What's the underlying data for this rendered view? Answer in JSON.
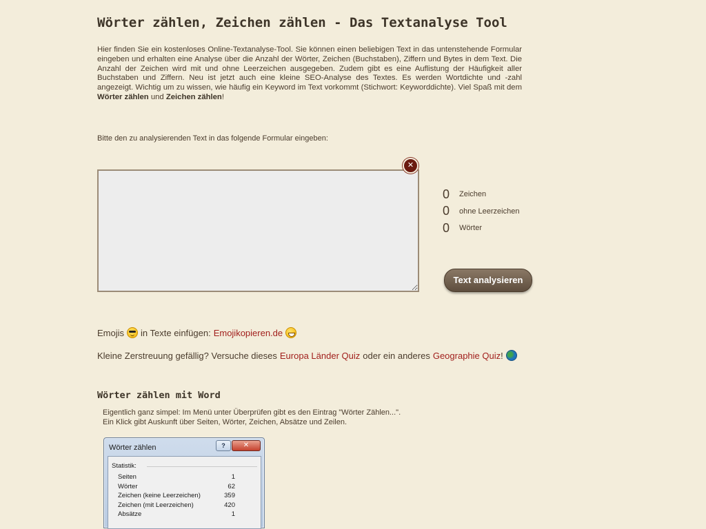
{
  "header": {
    "title": "Wörter zählen, Zeichen zählen - Das Textanalyse Tool"
  },
  "intro": {
    "text_a": "Hier finden Sie ein kostenloses Online-Textanalyse-Tool. Sie können einen beliebigen Text in das untenstehende Formular eingeben und erhalten eine Analyse über die Anzahl der Wörter, Zeichen (Buchstaben), Ziffern und Bytes in dem Text. Die Anzahl der Zeichen wird mit und ohne Leerzeichen ausgegeben. Zudem gibt es eine Auflistung der Häufigkeit aller Buchstaben und Ziffern. Neu ist jetzt auch eine kleine SEO-Analyse des Textes. Es werden Wortdichte und -zahl angezeigt. Wichtig um zu wissen, wie häufig ein Keyword im Text vorkommt (Stichwort: Keyworddichte). Viel Spaß mit dem ",
    "bold_a": "Wörter zählen",
    "text_b": " und ",
    "bold_b": "Zeichen zählen",
    "text_c": "!"
  },
  "form": {
    "prompt": "Bitte den zu analysierenden Text in das folgende Formular eingeben:",
    "textarea_value": "",
    "clear_symbol": "✕",
    "analyze_label": "Text analysieren"
  },
  "counts": [
    {
      "value": "0",
      "label": "Zeichen"
    },
    {
      "value": "0",
      "label": "ohne Leerzeichen"
    },
    {
      "value": "0",
      "label": "Wörter"
    }
  ],
  "emoji_line": {
    "prefix": "Emojis",
    "middle": "in Texte einfügen:",
    "link": "Emojikopieren.de",
    "icons": [
      "smiling-face-with-sunglasses-icon",
      "grinning-sweat-face-icon"
    ]
  },
  "quiz_line": {
    "prefix": "Kleine Zerstreuung gefällig? Versuche dieses",
    "link1": "Europa Länder Quiz",
    "middle": "oder ein anderes",
    "link2": "Geographie Quiz",
    "suffix": "!",
    "icon": "globe-icon"
  },
  "word_section": {
    "heading": "Wörter zählen mit Word",
    "line1": "Eigentlich ganz simpel: Im Menü unter Überprüfen gibt es den Eintrag \"Wörter Zählen...\".",
    "line2": "Ein Klick gibt Auskunft über Seiten, Wörter, Zeichen, Absätze und Zeilen."
  },
  "word_dialog": {
    "title": "Wörter zählen",
    "help_symbol": "?",
    "close_symbol": "✕",
    "stat_heading": "Statistik:",
    "rows": [
      {
        "label": "Seiten",
        "value": "1"
      },
      {
        "label": "Wörter",
        "value": "62"
      },
      {
        "label": "Zeichen (keine Leerzeichen)",
        "value": "359"
      },
      {
        "label": "Zeichen (mit Leerzeichen)",
        "value": "420"
      },
      {
        "label": "Absätze",
        "value": "1"
      }
    ]
  },
  "colors": {
    "background": "#f3eddb",
    "text": "#4a3b2c",
    "link": "#a11f1c",
    "button": "#6f5e4c",
    "clear_button": "#6b1a10"
  }
}
